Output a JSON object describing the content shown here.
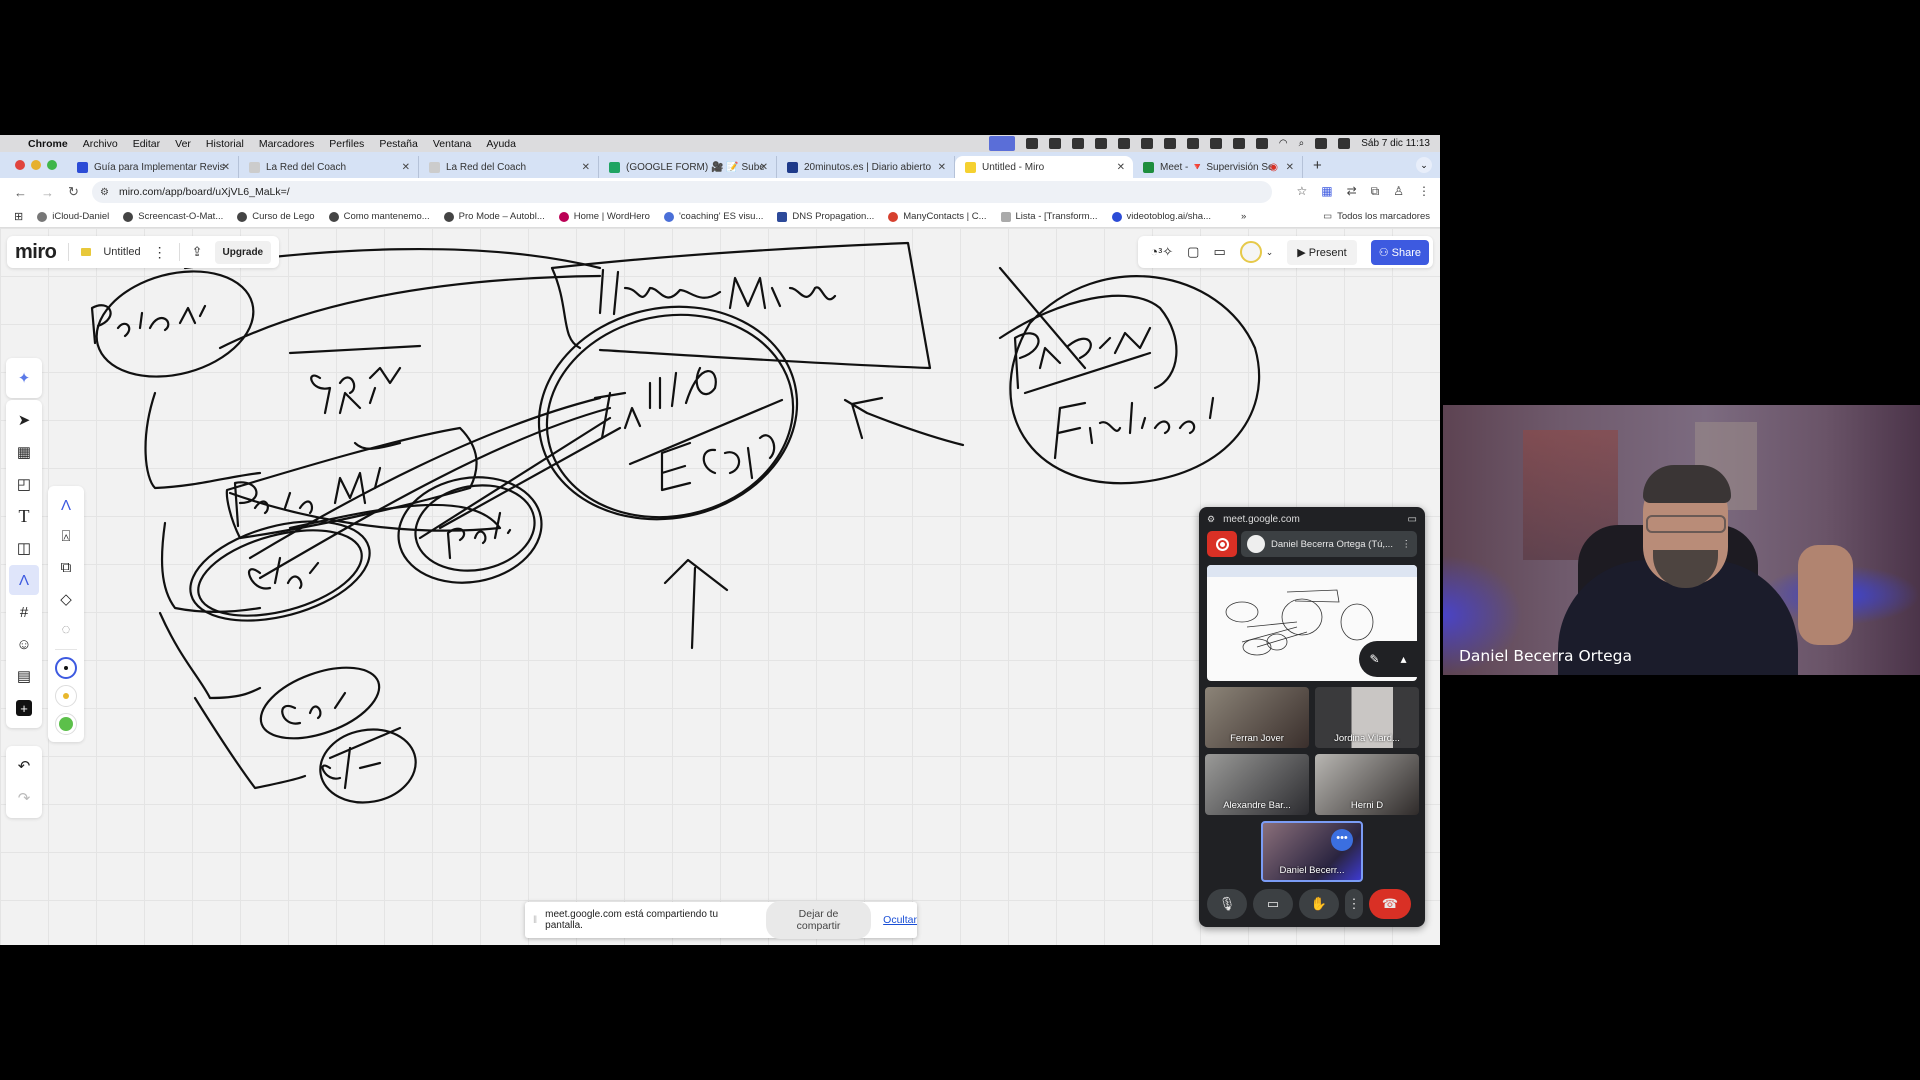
{
  "menubar": {
    "app": "Chrome",
    "items": [
      "Archivo",
      "Editar",
      "Ver",
      "Historial",
      "Marcadores",
      "Perfiles",
      "Pestaña",
      "Ventana",
      "Ayuda"
    ],
    "clock": "Sáb 7 dic 11:13"
  },
  "tabs": [
    {
      "title": "Guía para Implementar Revis",
      "favicon_color": "#2b4bd6"
    },
    {
      "title": "La Red del Coach",
      "favicon_color": "#cccccc"
    },
    {
      "title": "La Red del Coach",
      "favicon_color": "#cccccc"
    },
    {
      "title": "(GOOGLE FORM) 🎥 📝 Sube",
      "favicon_color": "#1fa463"
    },
    {
      "title": "20minutos.es | Diario abierto",
      "favicon_color": "#1e3a8a"
    },
    {
      "title": "Untitled - Miro",
      "favicon_color": "#f5d130",
      "active": true
    },
    {
      "title": "Meet - 🔻 Supervisión Se",
      "favicon_color": "#1e8e3e",
      "recording": true
    }
  ],
  "address": {
    "url": "miro.com/app/board/uXjVL6_MaLk=/"
  },
  "bookmarks": [
    "iCloud-Daniel",
    "Screencast-O-Mat...",
    "Curso de Lego",
    "Como mantenemo...",
    "Pro Mode – Autobl...",
    "Home | WordHero",
    "'coaching' ES visu...",
    "DNS Propagation...",
    "ManyContacts | C...",
    "Lista - [Transform...",
    "videotoblog.ai/sha..."
  ],
  "bookmarks_more": "»",
  "bookmarks_all": "Todos los marcadores",
  "miro": {
    "logo": "miro",
    "board_title": "Untitled",
    "upgrade_label": "Upgrade",
    "present_label": "Present",
    "share_label": "Share",
    "accent_color": "#3d5ae0",
    "board_text": [
      "Intern Meta",
      "Tabla Escaparate",
      "Propuesta Finalidad",
      "Polonji",
      "compr Int",
      "Pantalla",
      "Cala",
      "Paul",
      "Cos",
      "Sal"
    ]
  },
  "share_banner": {
    "message": "meet.google.com está compartiendo tu pantalla.",
    "stop_label": "Dejar de compartir",
    "hide_label": "Ocultar"
  },
  "meet": {
    "domain": "meet.google.com",
    "presenter": "Daniel Becerra Ortega (Tú,...",
    "participants": [
      {
        "name": "Ferran Jover"
      },
      {
        "name": "Jordina Vilard..."
      },
      {
        "name": "Alexandre Bar..."
      },
      {
        "name": "Herni D"
      },
      {
        "name": "Daniel Becerr...",
        "self": true
      }
    ]
  },
  "webcam": {
    "name": "Daniel Becerra Ortega"
  }
}
